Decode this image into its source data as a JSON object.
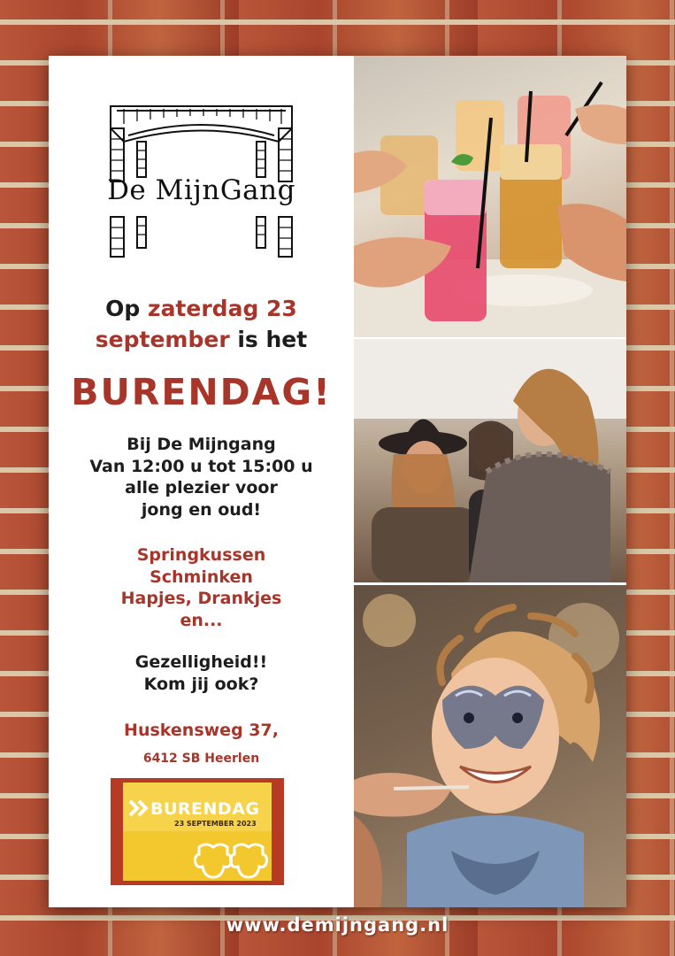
{
  "logo": {
    "name": "De MijnGang"
  },
  "headline": {
    "part1": "Op ",
    "part2": "zaterdag 23",
    "part3": "september",
    "part4": " is het"
  },
  "title": "BURENDAG!",
  "details": [
    "Bij De Mijngang",
    "Van 12:00 u tot 15:00 u",
    "alle plezier voor",
    "jong en oud!"
  ],
  "activities": [
    "Springkussen",
    "Schminken",
    "Hapjes, Drankjes",
    "en..."
  ],
  "closing": [
    "Gezelligheid!!",
    "Kom jij ook?"
  ],
  "address": {
    "street": "Huskensweg 37,",
    "city": "6412 SB Heerlen"
  },
  "badge": {
    "title": "BURENDAG",
    "date": "23 SEPTEMBER 2023"
  },
  "website": "www.demijngang.nl",
  "photos": [
    "drinks-toast-photo",
    "friends-laughing-photo",
    "child-face-paint-photo"
  ],
  "colors": {
    "accent_red": "#a8352a",
    "badge_yellow": "#f3c72e",
    "badge_red": "#b73a24"
  }
}
